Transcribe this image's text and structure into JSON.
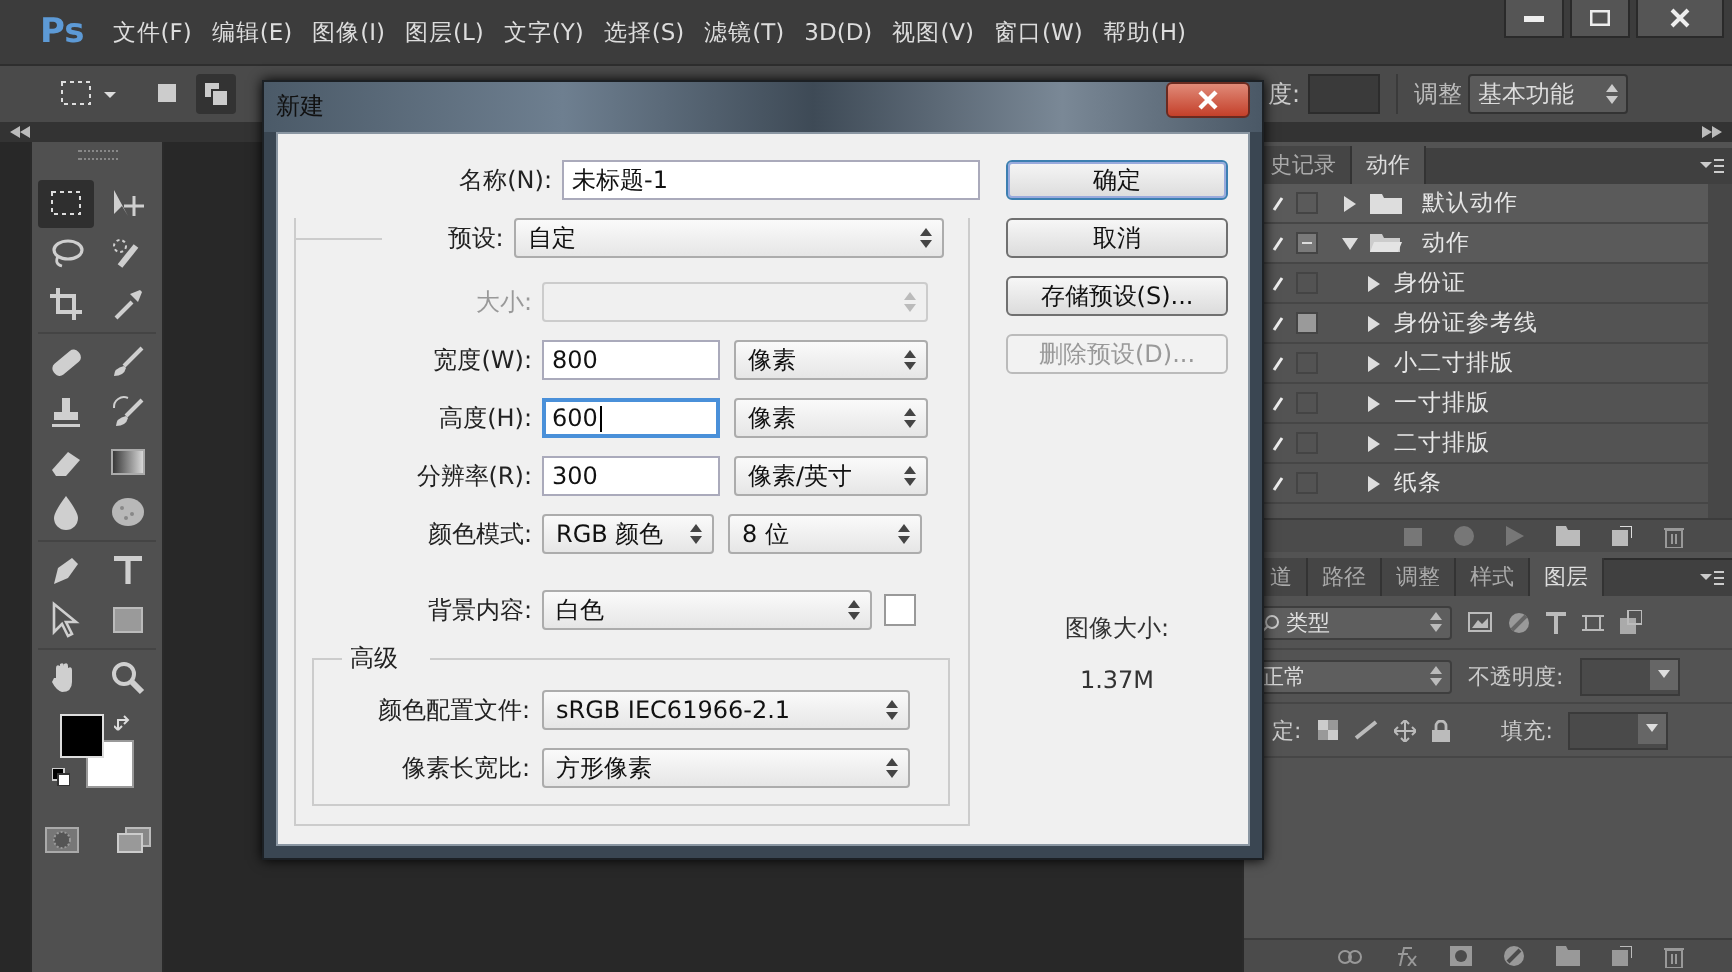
{
  "app": {
    "logo": "Ps"
  },
  "menu": [
    "文件(F)",
    "编辑(E)",
    "图像(I)",
    "图层(L)",
    "文字(Y)",
    "选择(S)",
    "滤镜(T)",
    "3D(D)",
    "视图(V)",
    "窗口(W)",
    "帮助(H)"
  ],
  "options_bar": {
    "selection_modes": [
      {
        "kind": "new",
        "selected": false
      },
      {
        "kind": "add",
        "selected": true
      }
    ],
    "partial_label": "度:",
    "workspace_label": "调整",
    "workspace": "基本功能"
  },
  "tools": [
    {
      "kind": "marquee",
      "selected": true
    },
    {
      "kind": "move",
      "selected": false
    },
    {
      "kind": "lasso",
      "selected": false
    },
    {
      "kind": "quick_select",
      "selected": false
    },
    {
      "kind": "crop",
      "selected": false
    },
    {
      "kind": "eyedropper",
      "selected": false
    },
    {
      "kind": "healing",
      "selected": false
    },
    {
      "kind": "brush",
      "selected": false
    },
    {
      "kind": "stamp",
      "selected": false
    },
    {
      "kind": "history_brush",
      "selected": false
    },
    {
      "kind": "eraser",
      "selected": false
    },
    {
      "kind": "gradient",
      "selected": false
    },
    {
      "kind": "blur",
      "selected": false
    },
    {
      "kind": "sponge",
      "selected": false
    },
    {
      "kind": "pen",
      "selected": false
    },
    {
      "kind": "type",
      "selected": false
    },
    {
      "kind": "path_select",
      "selected": false
    },
    {
      "kind": "rectangle",
      "selected": false
    },
    {
      "kind": "hand",
      "selected": false
    },
    {
      "kind": "zoom",
      "selected": false
    }
  ],
  "dialog": {
    "title": "新建",
    "name": {
      "label": "名称(N):",
      "value": "未标题-1"
    },
    "preset": {
      "label": "预设:",
      "value": "自定"
    },
    "rows": [
      {
        "kind": "select",
        "label": "大小:",
        "disabled": true
      },
      {
        "kind": "input_unit",
        "label": "宽度(W):",
        "value": "800",
        "unit": "像素",
        "disabled": false,
        "focused": false
      },
      {
        "kind": "input_unit",
        "label": "高度(H):",
        "value": "600",
        "unit": "像素",
        "disabled": false,
        "focused": true
      },
      {
        "kind": "input_unit",
        "label": "分辨率(R):",
        "value": "300",
        "unit": "像素/英寸",
        "disabled": false,
        "focused": false
      },
      {
        "kind": "select_pair",
        "label": "颜色模式:",
        "value": "RGB 颜色",
        "unit": "8 位",
        "disabled": false
      },
      {
        "kind": "select_swatch",
        "label": "背景内容:",
        "value": "白色",
        "color": "#ffffff",
        "disabled": false
      }
    ],
    "advanced": {
      "title": "高级",
      "rows": [
        {
          "label": "颜色配置文件:",
          "value": "sRGB IEC61966-2.1"
        },
        {
          "label": "像素长宽比:",
          "value": "方形像素"
        }
      ]
    },
    "buttons": [
      {
        "label": "确定",
        "default": true,
        "disabled": false
      },
      {
        "label": "取消",
        "default": false,
        "disabled": false
      },
      {
        "label": "存储预设(S)...",
        "default": false,
        "disabled": false
      },
      {
        "label": "删除预设(D)...",
        "default": false,
        "disabled": true
      }
    ],
    "image_size": {
      "label": "图像大小:",
      "value": "1.37M"
    }
  },
  "actions_panel": {
    "tabs": [
      {
        "label": "史记录",
        "selected": false
      },
      {
        "label": "动作",
        "selected": true
      }
    ],
    "items": [
      {
        "name": "默认动作",
        "folder": true,
        "enabled": true,
        "dialog_toggle": false,
        "expanded": false
      },
      {
        "name": "动作",
        "folder": true,
        "enabled": true,
        "dialog_toggle": true,
        "expanded": true,
        "children": [
          {
            "name": "身份证",
            "folder": false,
            "enabled": true,
            "dialog_toggle": false,
            "expanded": false
          },
          {
            "name": "身份证参考线",
            "folder": false,
            "enabled": true,
            "dialog_toggle": true,
            "expanded": false
          },
          {
            "name": "小二寸排版",
            "folder": false,
            "enabled": true,
            "dialog_toggle": false,
            "expanded": false
          },
          {
            "name": "一寸排版",
            "folder": false,
            "enabled": true,
            "dialog_toggle": false,
            "expanded": false
          },
          {
            "name": "二寸排版",
            "folder": false,
            "enabled": true,
            "dialog_toggle": false,
            "expanded": false
          },
          {
            "name": "纸条",
            "folder": false,
            "enabled": true,
            "dialog_toggle": false,
            "expanded": false
          }
        ]
      }
    ]
  },
  "layers_panel": {
    "tabs": [
      {
        "label": "道",
        "selected": false
      },
      {
        "label": "路径",
        "selected": false
      },
      {
        "label": "调整",
        "selected": false
      },
      {
        "label": "样式",
        "selected": false
      },
      {
        "label": "图层",
        "selected": true
      }
    ],
    "filter": "类型",
    "blend_mode": "正常",
    "opacity_label": "不透明度:",
    "lock_label": "定:",
    "fill_label": "填充:"
  }
}
